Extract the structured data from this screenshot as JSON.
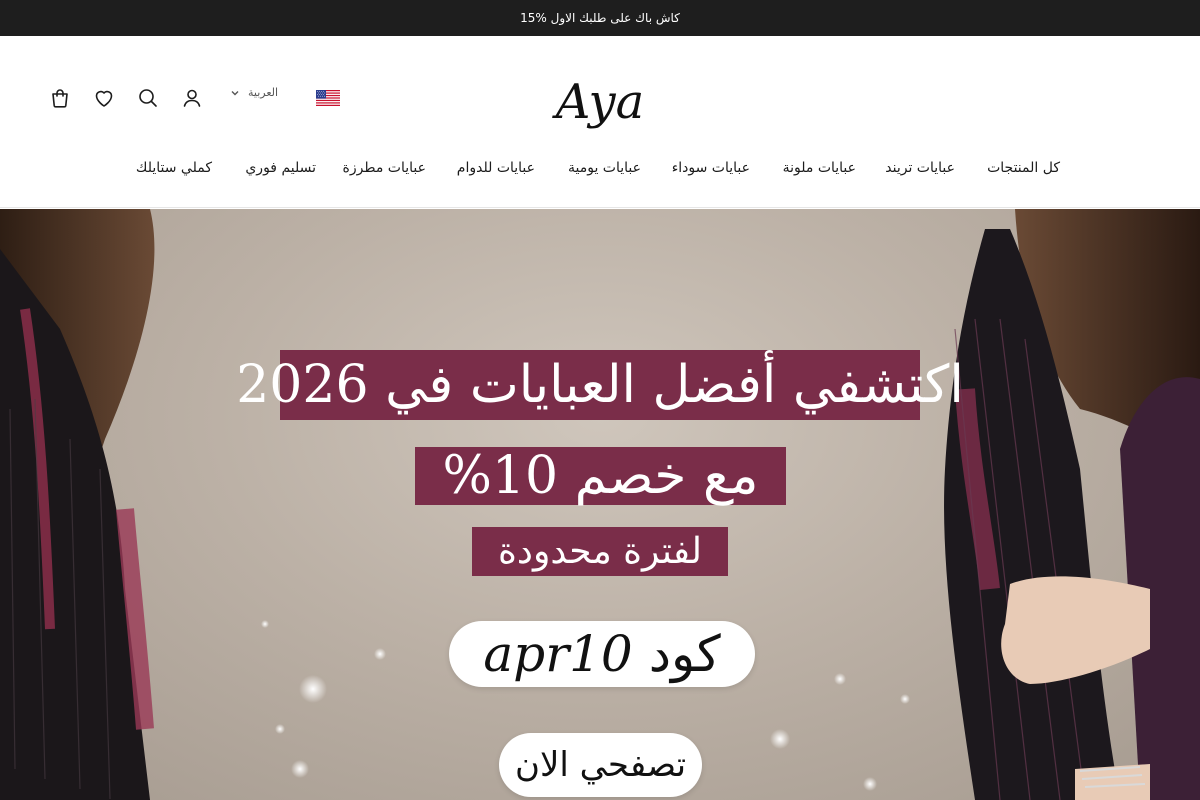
{
  "announcement": {
    "text": "15% كاش باك على طلبك الاول"
  },
  "header": {
    "logo_text": "Aya",
    "language_label": "العربية",
    "flag": "us-flag",
    "icons": [
      "cart-icon",
      "wishlist-icon",
      "search-icon",
      "account-icon"
    ]
  },
  "nav": {
    "items": [
      {
        "label": "كل المنتجات"
      },
      {
        "label": "عبايات تريند"
      },
      {
        "label": "عبايات ملونة"
      },
      {
        "label": "عبايات سوداء"
      },
      {
        "label": "عبايات يومية"
      },
      {
        "label": "عبايات للدوام"
      },
      {
        "label": "عبايات مطرزة"
      },
      {
        "label": "تسليم فوري"
      },
      {
        "label": "كملي ستايلك"
      }
    ]
  },
  "hero": {
    "line1": "اكتشفي أفضل العبايات في 2026",
    "line2": "مع خصم 10%",
    "line3": "لفترة محدودة",
    "code_label": "كود",
    "code_value": "apr10",
    "cta": "تصفحي الان"
  },
  "colors": {
    "announcement_bg": "#1e1e1e",
    "banner_bg": "#7a2d49",
    "hero_bg": "#bcb1a6"
  }
}
